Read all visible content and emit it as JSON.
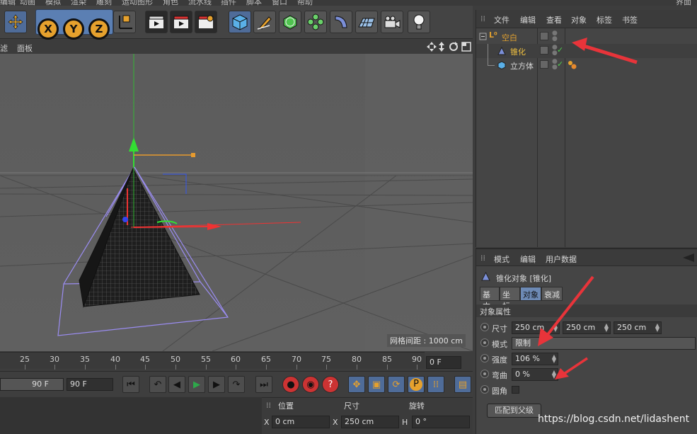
{
  "menubar": {
    "items": [
      "编辑",
      "动画",
      "模拟",
      "渲染",
      "雕刻",
      "运动图形",
      "角色",
      "流水线",
      "插件",
      "脚本",
      "窗口",
      "帮助"
    ],
    "right": "界面"
  },
  "toolbar": {
    "x": "X",
    "y": "Y",
    "z": "Z"
  },
  "viewport_menu": {
    "filter": "滤",
    "panel": "面板",
    "nav_icons": [
      "move-view-icon",
      "dolly-view-icon",
      "rotate-view-icon",
      "maximize-view-icon"
    ]
  },
  "viewport": {
    "grid_spacing": "网格间距 : 1000 cm"
  },
  "timeline": {
    "ticks": [
      "25",
      "30",
      "35",
      "40",
      "45",
      "50",
      "55",
      "60",
      "65",
      "70",
      "75",
      "80",
      "85",
      "90"
    ],
    "current_frame": "0 F",
    "end_frame_a": "90 F",
    "end_frame_b": "90 F"
  },
  "object_manager": {
    "menu": [
      "文件",
      "编辑",
      "查看",
      "对象",
      "标签",
      "书签"
    ],
    "objects": [
      {
        "name": "空白",
        "color": "#e0a030",
        "indent": "root",
        "icon": "null-object-icon"
      },
      {
        "name": "锥化",
        "color": "#f0c040",
        "indent": "child",
        "icon": "taper-deformer-icon"
      },
      {
        "name": "立方体",
        "color": "#d8d8d8",
        "indent": "child",
        "icon": "cube-icon"
      }
    ]
  },
  "attributes": {
    "menu": [
      "模式",
      "编辑",
      "用户数据"
    ],
    "title": "锥化对象 [锥化]",
    "tabs": [
      "基本",
      "坐标",
      "对象",
      "衰减"
    ],
    "active_tab": "对象",
    "section": "对象属性",
    "size_label": "尺寸",
    "size": [
      "250 cm",
      "250 cm",
      "250 cm"
    ],
    "mode_label": "模式",
    "mode": "限制",
    "strength_label": "强度",
    "strength": "106 %",
    "curvature_label": "弯曲",
    "curvature": "0 %",
    "fillet_label": "圆角",
    "fit_button": "匹配到父级"
  },
  "coordinates": {
    "position": "位置",
    "size": "尺寸",
    "rotation": "旋转",
    "x_label": "X",
    "x_pos": "0 cm",
    "x2_label": "X",
    "x_size": "250 cm",
    "h_label": "H",
    "h_rot": "0 °"
  },
  "watermark": "https://blog.csdn.net/lidashent",
  "colors": {
    "accent": "#6d8ab5",
    "annotation": "#e8343a"
  }
}
